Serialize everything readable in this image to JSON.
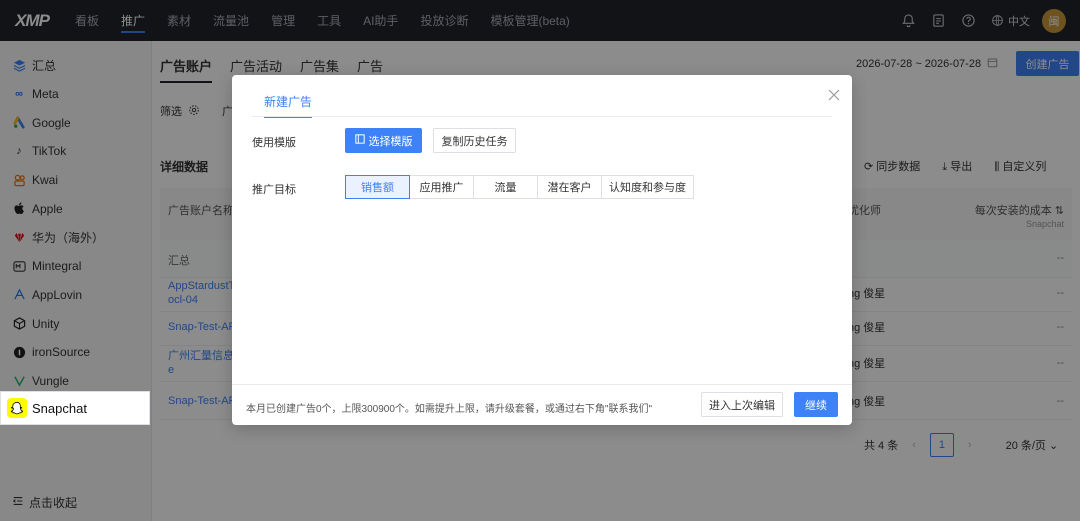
{
  "topbar": {
    "logo": "XMP",
    "nav": [
      "看板",
      "推广",
      "素材",
      "流量池",
      "管理",
      "工具",
      "AI助手",
      "投放诊断",
      "模板管理(beta)"
    ],
    "active_nav": "推广",
    "lang": "中文",
    "avatar": "闽"
  },
  "sidebar": {
    "items": [
      {
        "label": "汇总",
        "icon": "layers-icon",
        "color": "#3e82f7"
      },
      {
        "label": "Meta",
        "icon": "meta-icon",
        "color": "#1877f2"
      },
      {
        "label": "Google",
        "icon": "google-ads-icon",
        "color": "#34a853"
      },
      {
        "label": "TikTok",
        "icon": "tiktok-icon",
        "color": "#111111"
      },
      {
        "label": "Kwai",
        "icon": "kwai-icon",
        "color": "#ff6a00"
      },
      {
        "label": "Apple",
        "icon": "apple-icon",
        "color": "#111111"
      },
      {
        "label": "华为（海外）",
        "icon": "huawei-icon",
        "color": "#e60012"
      },
      {
        "label": "Mintegral",
        "icon": "mintegral-icon",
        "color": "#333333"
      },
      {
        "label": "AppLovin",
        "icon": "applovin-icon",
        "color": "#1e7df0"
      },
      {
        "label": "Unity",
        "icon": "unity-icon",
        "color": "#222222"
      },
      {
        "label": "ironSource",
        "icon": "ironsource-icon",
        "color": "#222222"
      },
      {
        "label": "Vungle",
        "icon": "vungle-icon",
        "color": "#28b46e"
      }
    ],
    "active_item": "Snapchat",
    "collapse_label": "点击收起"
  },
  "main": {
    "tabs": [
      "广告账户",
      "广告活动",
      "广告集",
      "广告"
    ],
    "date_range": "2026-07-28 ~ 2026-07-28",
    "create_button": "创建广告",
    "filter_label": "筛选",
    "filter_partial": "广",
    "section_title": "详细数据",
    "actions": [
      "同步数据",
      "导出",
      "自定义列"
    ],
    "table": {
      "col_name": "广告账户名称",
      "col_optimizer": "优化师",
      "col_cost": "每次安装的成本",
      "col_cost_sub": "Snapchat",
      "summary_label": "汇总",
      "summary_value": "--",
      "rows": [
        {
          "name": "AppStardustTT\nocl-04",
          "optimizer": "ng 俊星",
          "cost": "--"
        },
        {
          "name": "Snap-Test-AP",
          "optimizer": "ng 俊星",
          "cost": "--"
        },
        {
          "name": "广州汇量信息科\ne",
          "optimizer": "ng 俊星",
          "cost": "--"
        },
        {
          "name": "Snap-Test-AP",
          "optimizer": "ng 俊星",
          "cost": "--"
        }
      ]
    },
    "pager": {
      "total": "共 4 条",
      "page": "1",
      "size": "20 条/页"
    }
  },
  "modal": {
    "tab": "新建广告",
    "template_label": "使用模版",
    "select_template_btn": "选择模版",
    "copy_history_btn": "复制历史任务",
    "goal_label": "推广目标",
    "goals": [
      "销售额",
      "应用推广",
      "流量",
      "潜在客户",
      "认知度和参与度"
    ],
    "active_goal": "销售额",
    "note": "本月已创建广告0个，上限300900个。如需提升上限，请升级套餐，或通过右下角\"联系我们\"",
    "last_edit_btn": "进入上次编辑",
    "continue_btn": "继续"
  },
  "colors": {
    "accent": "#3e82f7",
    "topbar": "#1f2329",
    "snapchat": "#fffc00"
  }
}
